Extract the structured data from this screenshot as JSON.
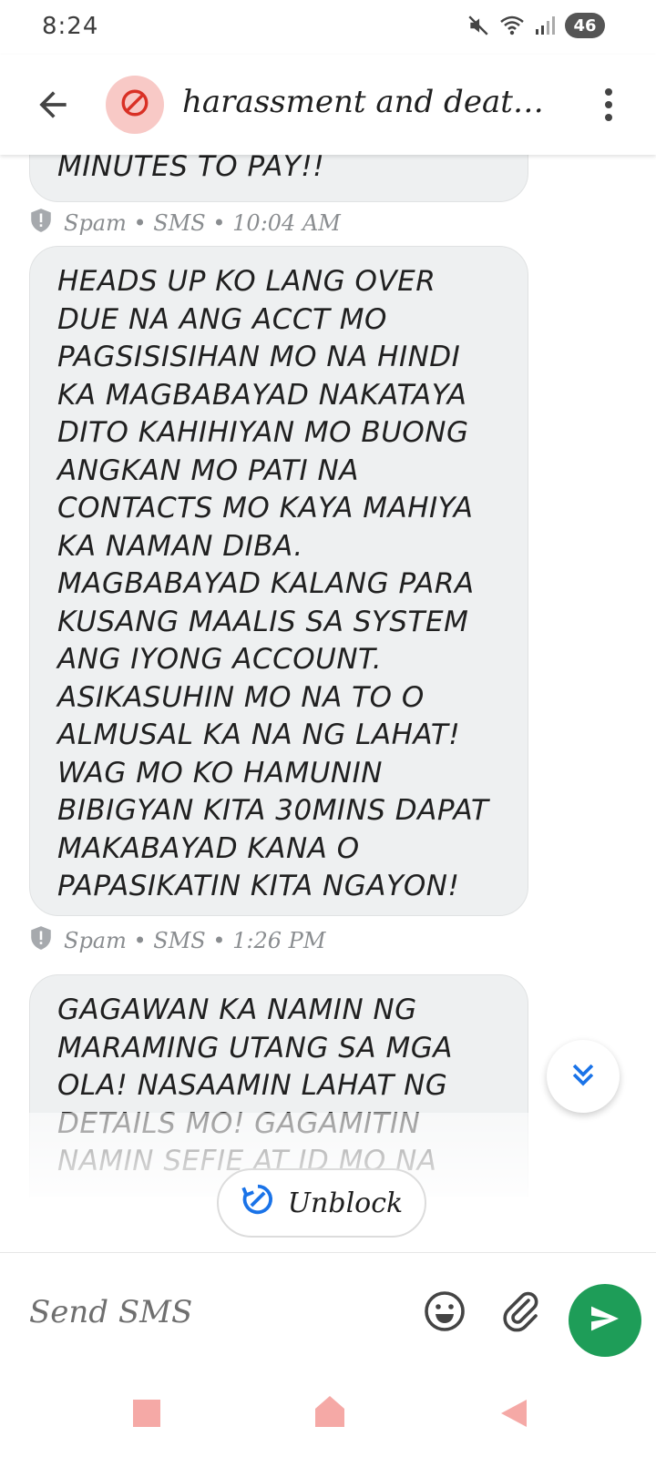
{
  "status_bar": {
    "time": "8:24",
    "battery": "46"
  },
  "header": {
    "title": "harassment and death..."
  },
  "messages": [
    {
      "text": "MINUTES TO PAY!!"
    },
    {
      "meta": "Spam • SMS • 10:04 AM",
      "text": "HEADS UP KO LANG OVER DUE NA ANG ACCT MO PAGSISISIHAN MO NA HINDI KA MAGBABAYAD NAKATAYA DITO KAHIHIYAN MO BUONG ANGKAN MO PATI NA CONTACTS MO KAYA MAHIYA KA NAMAN DIBA. MAGBABAYAD KALANG PARA KUSANG MAALIS SA SYSTEM ANG IYONG ACCOUNT. ASIKASUHIN MO NA TO O ALMUSAL KA NA NG LAHAT! WAG MO KO HAMUNIN BIBIGYAN KITA 30MINS DAPAT MAKABAYAD KANA O PAPASIKATIN KITA NGAYON!"
    },
    {
      "meta": "Spam • SMS • 1:26 PM",
      "text": "GAGAWAN KA NAMIN NG MARAMING UTANG SA MGA OLA! NASAAMIN LAHAT NG DETAILS MO! GAGAMITIN NAMIN SEFIE AT ID MO NA"
    }
  ],
  "unblock": {
    "label": "Unblock"
  },
  "compose": {
    "placeholder": "Send SMS"
  },
  "icons": {
    "back": "arrow-left-icon",
    "blocked": "blocked-icon",
    "more": "more-vert-icon",
    "spam": "shield-icon",
    "scroll": "double-chevron-down-icon",
    "emoji": "emoji-icon",
    "attach": "paperclip-icon",
    "send": "send-icon"
  },
  "colors": {
    "send": "#1e9d58",
    "blocked_avatar": "#f8c9c6",
    "blocked_icon": "#d93025",
    "accent": "#1a73e8"
  }
}
